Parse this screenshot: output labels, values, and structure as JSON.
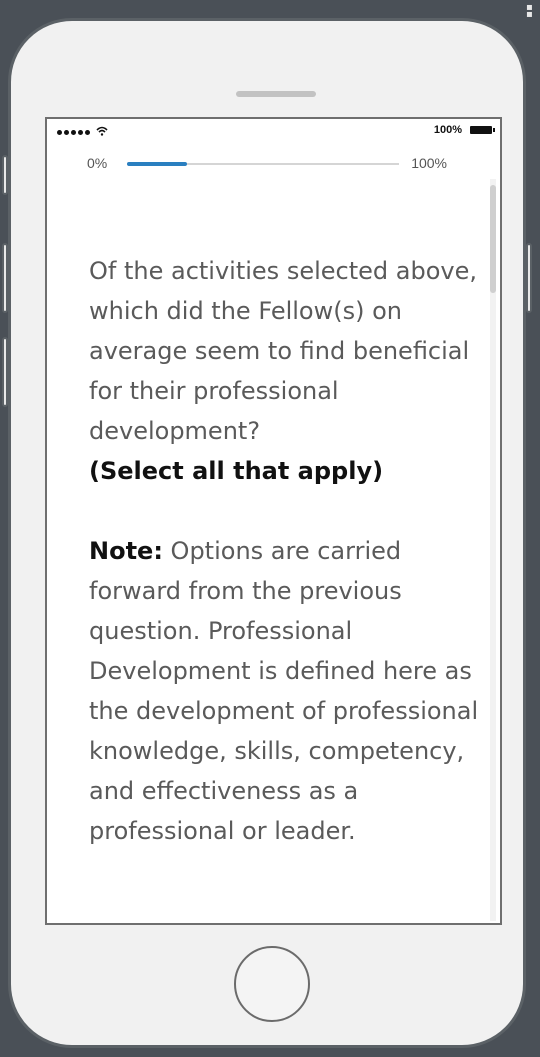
{
  "status_bar": {
    "signal_icon": "signal-dots-icon",
    "wifi_icon": "wifi-icon",
    "battery_percent": "100%",
    "battery_icon": "battery-icon"
  },
  "progress": {
    "start_label": "0%",
    "end_label": "100%",
    "value": 0.22,
    "fill_color": "#2a7fc0"
  },
  "survey": {
    "question": "Of the activities selected above, which did the Fellow(s) on average seem to find beneficial for their professional development?",
    "instruction": "(Select all that apply)",
    "note_label": "Note:",
    "note_text": " Options are carried forward from the previous question. Professional Development is defined here as the development of professional knowledge, skills, competency, and effectiveness as a professional or leader."
  },
  "colors": {
    "background": "#4a5057",
    "phone_body": "#f1f1f1",
    "accent": "#2a7fc0"
  }
}
